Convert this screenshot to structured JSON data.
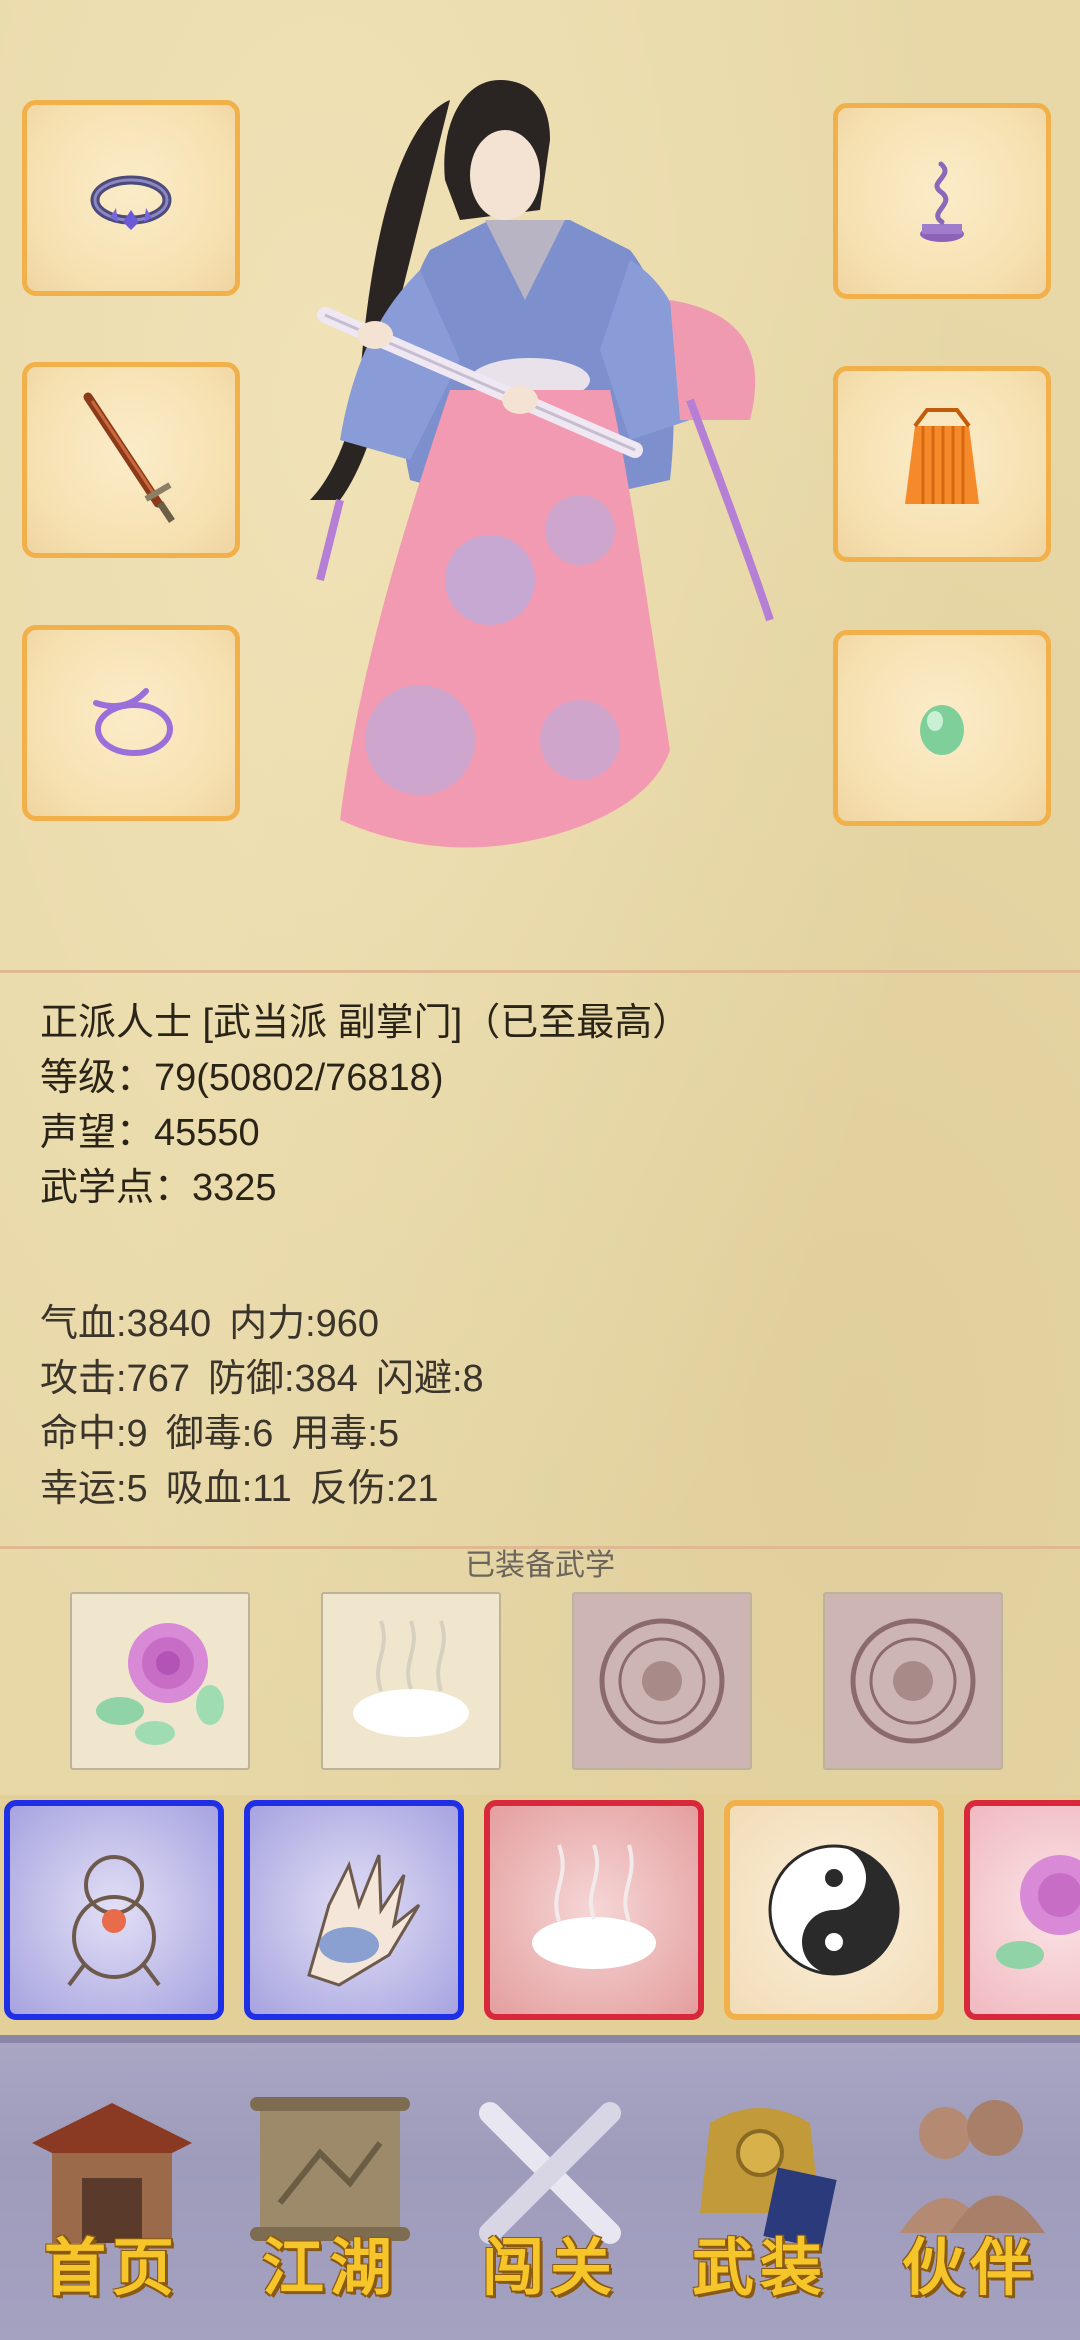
{
  "character": {
    "faction_line": "正派人士 [武当派 副掌门]（已至最高）",
    "level_line": "等级：79(50802/76818)",
    "prestige_line": "声望：45550",
    "martial_points_line": "武学点：3325"
  },
  "stats": {
    "hp": "气血:3840",
    "mp": "内力:960",
    "attack": "攻击:767",
    "defense": "防御:384",
    "dodge": "闪避:8",
    "hit": "命中:9",
    "poison_resist": "御毒:6",
    "poison_use": "用毒:5",
    "luck": "幸运:5",
    "lifesteal": "吸血:11",
    "reflect": "反伤:21"
  },
  "equipped_skills_label": "已装备武学",
  "nav": {
    "home": "首页",
    "jianghu": "江湖",
    "challenge": "闯关",
    "equip": "武装",
    "partner": "伙伴"
  },
  "colors": {
    "slot_border": "#f2b04a",
    "nav_bg": "#a9a6c4",
    "nav_text": "#f5c52a",
    "blue_frame": "#1f2fe6",
    "red_frame": "#d8283c",
    "orange_frame": "#f2b04a"
  }
}
